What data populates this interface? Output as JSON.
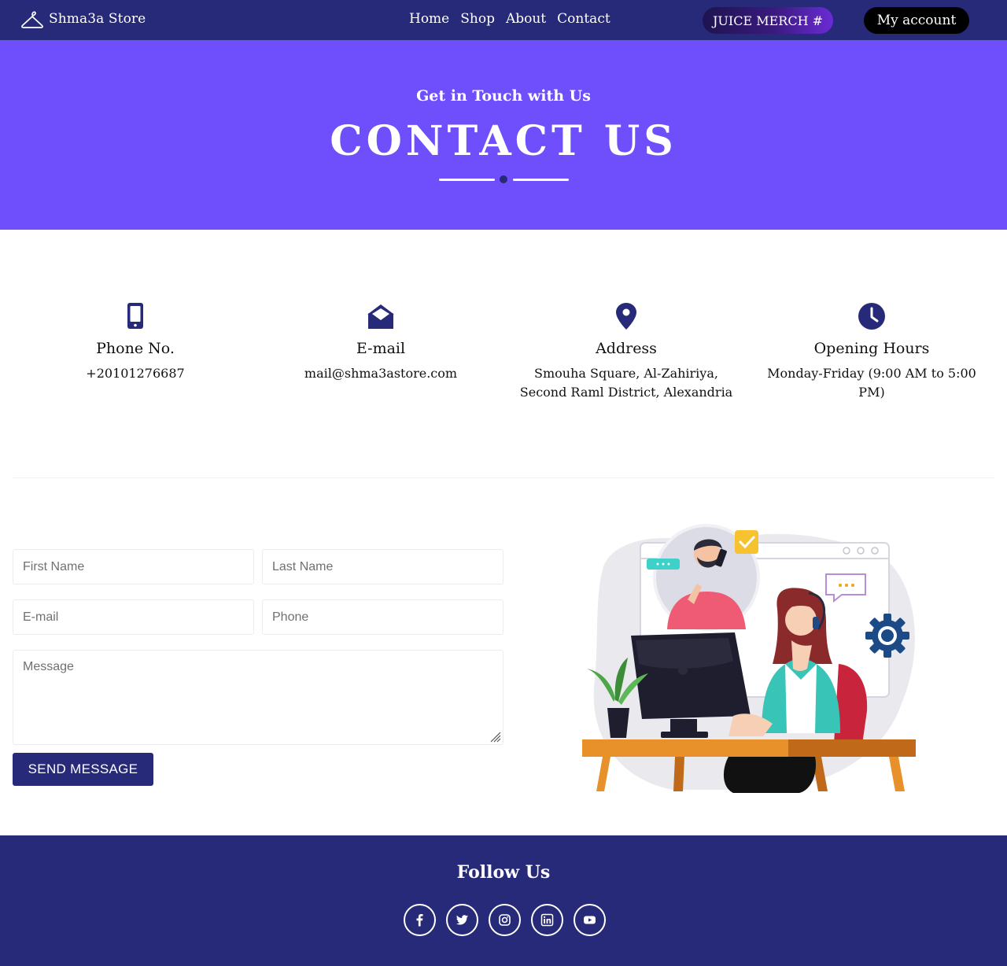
{
  "nav": {
    "brand": "Shma3a Store",
    "brand_icon": "hanger-icon",
    "links": [
      "Home",
      "Shop",
      "About",
      "Contact"
    ],
    "juice_button": "JUICE MERCH #",
    "account_button": "My account"
  },
  "hero": {
    "subtitle": "Get in Touch with Us",
    "title": "CONTACT US"
  },
  "info": [
    {
      "icon": "mobile-phone-icon",
      "title": "Phone No.",
      "value": "+20101276687"
    },
    {
      "icon": "envelope-open-icon",
      "title": "E-mail",
      "value": "mail@shma3astore.com"
    },
    {
      "icon": "map-pin-icon",
      "title": "Address",
      "value": "Smouha Square, Al-Zahiriya, Second Raml District, Alexandria"
    },
    {
      "icon": "clock-icon",
      "title": "Opening Hours",
      "value": "Monday-Friday (9:00 AM to 5:00 PM)"
    }
  ],
  "form": {
    "first_name_placeholder": "First Name",
    "last_name_placeholder": "Last Name",
    "email_placeholder": "E-mail",
    "phone_placeholder": "Phone",
    "message_placeholder": "Message",
    "submit_label": "SEND MESSAGE"
  },
  "footer": {
    "follow_title": "Follow Us",
    "socials": [
      "facebook-icon",
      "twitter-icon",
      "instagram-icon",
      "linkedin-icon",
      "youtube-icon"
    ]
  },
  "colors": {
    "navy": "#262a78",
    "hero_purple": "#6e4ffb",
    "white": "#ffffff"
  }
}
